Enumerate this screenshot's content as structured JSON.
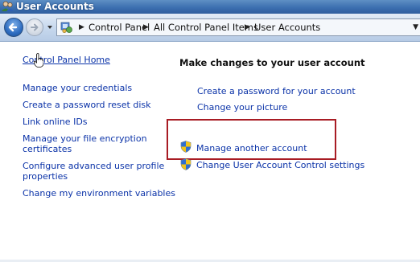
{
  "window": {
    "title": "User Accounts"
  },
  "address": {
    "crumbs": [
      "Control Panel",
      "All Control Panel Items",
      "User Accounts"
    ]
  },
  "left_panel": {
    "home_link": "Control Panel Home",
    "tasks": [
      "Manage your credentials",
      "Create a password reset disk",
      "Link online IDs",
      "Manage your file encryption",
      "certificates",
      "Configure advanced user profile",
      "properties",
      "Change my environment variables"
    ]
  },
  "main": {
    "heading": "Make changes to your user account",
    "links": {
      "create_password": "Create a password for your account",
      "change_picture": "Change your picture",
      "manage_another": "Manage another account",
      "uac_settings": "Change User Account Control settings"
    }
  },
  "colors": {
    "link": "#0b33a8",
    "highlight_border": "#a81c24",
    "titlebar": "#3c6fb0"
  },
  "icons": {
    "back": "back-arrow-icon",
    "forward": "forward-arrow-icon",
    "shield": "uac-shield-icon",
    "control_panel": "control-panel-icon"
  }
}
